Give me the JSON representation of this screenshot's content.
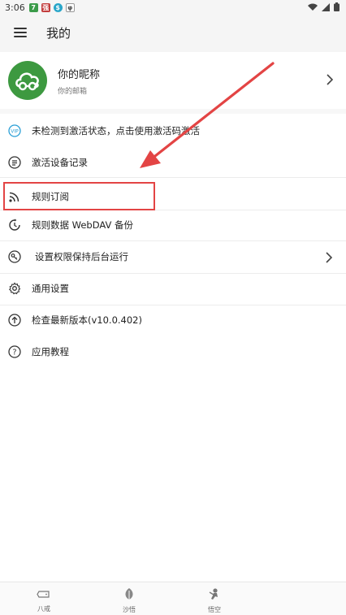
{
  "status_bar": {
    "time": "3:06"
  },
  "header": {
    "title": "我的"
  },
  "profile": {
    "nickname": "你的昵称",
    "email": "你的邮箱"
  },
  "menu": {
    "items": [
      {
        "label": "未检测到激活状态，点击使用激活码激活",
        "icon": "vip-badge-icon"
      },
      {
        "label": "激活设备记录",
        "icon": "list-icon"
      },
      {
        "label": "规则订阅",
        "icon": "rss-icon"
      },
      {
        "label": "规则数据 WebDAV 备份",
        "icon": "backup-clock-icon"
      },
      {
        "label": "设置权限保持后台运行",
        "icon": "permission-icon"
      },
      {
        "label": "通用设置",
        "icon": "gear-icon"
      },
      {
        "label": "检查最新版本(v10.0.402)",
        "icon": "upload-icon"
      },
      {
        "label": "应用教程",
        "icon": "help-icon"
      }
    ]
  },
  "bottom_nav": {
    "tabs": [
      {
        "label": "八戒",
        "icon": "pig-icon"
      },
      {
        "label": "沙悟",
        "icon": "leaf-icon"
      },
      {
        "label": "悟空",
        "icon": "monkey-icon"
      }
    ]
  },
  "colors": {
    "avatar": "#3d9940",
    "annotation": "#e34444",
    "background": "#f7f7f7"
  }
}
